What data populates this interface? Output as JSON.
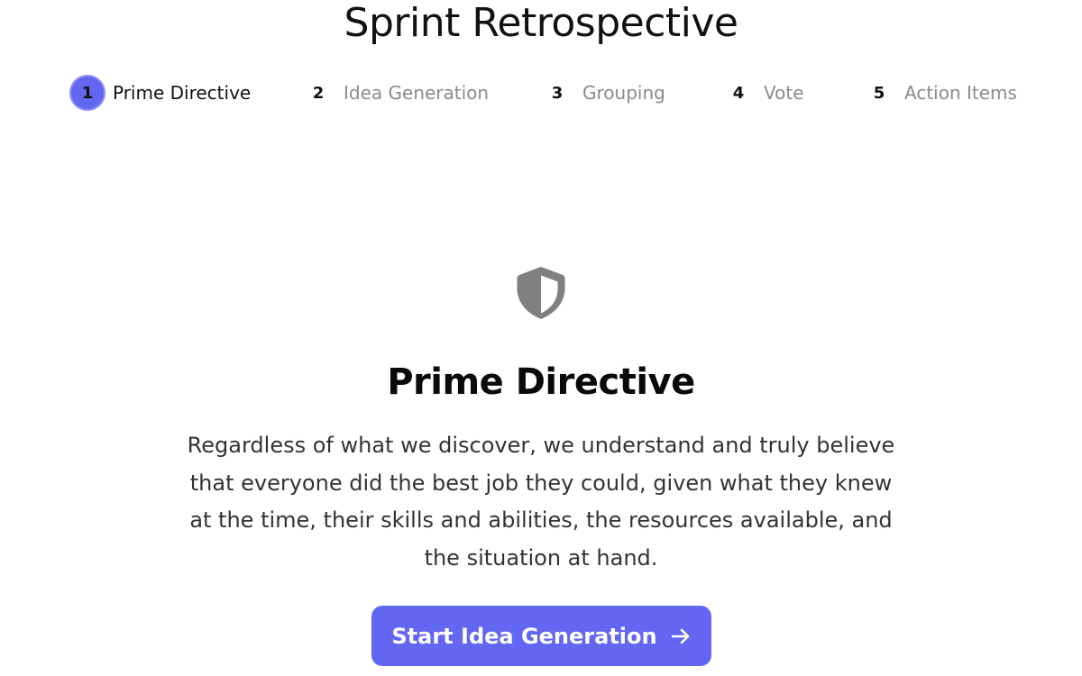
{
  "app": {
    "title": "Sprint Retrospective"
  },
  "steps": [
    {
      "number": "1",
      "label": "Prime Directive",
      "active": true
    },
    {
      "number": "2",
      "label": "Idea Generation",
      "active": false
    },
    {
      "number": "3",
      "label": "Grouping",
      "active": false
    },
    {
      "number": "4",
      "label": "Vote",
      "active": false
    },
    {
      "number": "5",
      "label": "Action Items",
      "active": false
    }
  ],
  "main": {
    "icon": "shield-icon",
    "heading": "Prime Directive",
    "body": "Regardless of what we discover, we understand and truly believe that everyone did the best job they could, given what they knew at the time, their skills and abilities, the resources available, and the situation at hand.",
    "cta_label": "Start Idea Generation",
    "cta_icon": "arrow-right-icon"
  },
  "colors": {
    "accent": "#6366f1",
    "accent_ring": "#8b8ff7",
    "inactive_text": "#8a8a8a",
    "icon_gray": "#808080"
  }
}
